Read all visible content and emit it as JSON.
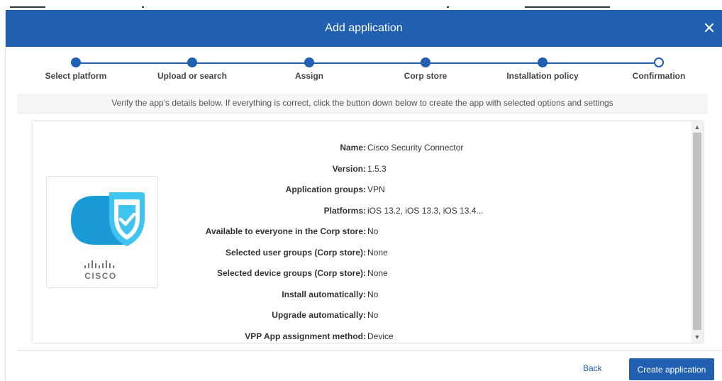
{
  "modal": {
    "title": "Add application",
    "close_icon": "close-icon"
  },
  "stepper": {
    "steps": [
      {
        "label": "Select platform",
        "completed": true
      },
      {
        "label": "Upload or search",
        "completed": true
      },
      {
        "label": "Assign",
        "completed": true
      },
      {
        "label": "Corp store",
        "completed": true
      },
      {
        "label": "Installation policy",
        "completed": true
      },
      {
        "label": "Confirmation",
        "completed": false
      }
    ]
  },
  "info_text": "Verify the app's details below. If everything is correct, click the button down below to create the app with selected options and settings",
  "app": {
    "logo_icon": "cisco-security-connector-icon",
    "brand_text": "CISCO",
    "details": [
      {
        "label": "Name:",
        "value": "Cisco Security Connector"
      },
      {
        "label": "Version:",
        "value": "1.5.3"
      },
      {
        "label": "Application groups:",
        "value": "VPN"
      },
      {
        "label": "Platforms:",
        "value": "iOS 13.2, iOS 13.3, iOS 13.4..."
      },
      {
        "label": "Available to everyone in the Corp store:",
        "value": "No"
      },
      {
        "label": "Selected user groups (Corp store):",
        "value": "None"
      },
      {
        "label": "Selected device groups (Corp store):",
        "value": "None"
      },
      {
        "label": "Install automatically:",
        "value": "No"
      },
      {
        "label": "Upgrade automatically:",
        "value": "No"
      },
      {
        "label": "VPP App assignment method:",
        "value": "Device"
      }
    ]
  },
  "footer": {
    "back_label": "Back",
    "create_label": "Create application"
  },
  "colors": {
    "accent": "#2160b1",
    "logo_blue": "#1a9bd7",
    "logo_light": "#3fc4f0"
  }
}
